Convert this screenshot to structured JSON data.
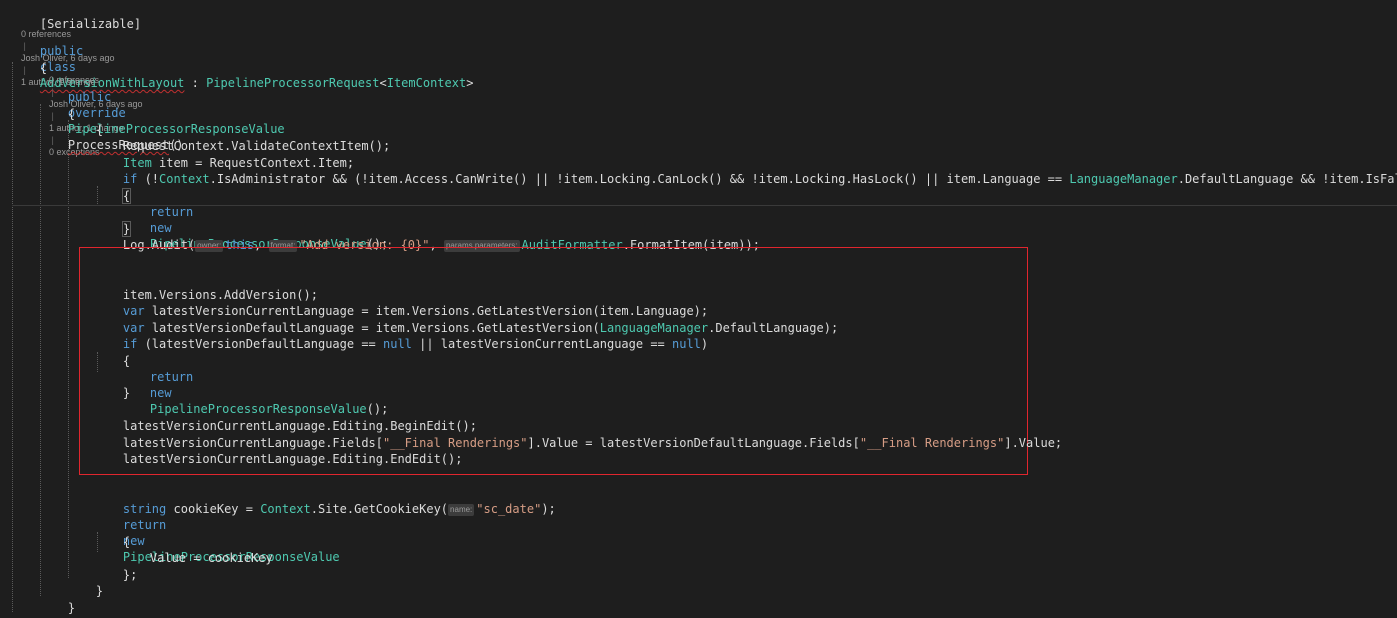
{
  "code": {
    "attribute_line": "[Serializable]",
    "class_lens": {
      "references": "0 references",
      "author": "Josh Oliver, 6 days ago",
      "changes": "1 author, 1 change"
    },
    "class_decl": {
      "kw1": "public",
      "kw2": "class",
      "name": "AddVersionWithLayout",
      "colon": " : ",
      "base": "PipelineProcessorRequest",
      "generic_open": "<",
      "generic_arg": "ItemContext",
      "generic_close": ">"
    },
    "method_lens": {
      "references": "0 references",
      "author": "Josh Oliver, 6 days ago",
      "changes": "1 author, 1 change",
      "exceptions": "0 exceptions"
    },
    "method_decl": {
      "kw1": "public",
      "kw2": "override",
      "return_type": "PipelineProcessorResponseValue",
      "name": "ProcessRequest",
      "parens": "()"
    },
    "open_brace": "{",
    "close_brace": "}",
    "l_validate": "RequestContext.ValidateContextItem();",
    "l_item_type": "Item",
    "l_item_rest": " item = RequestContext.Item;",
    "l_if_kw": "if",
    "l_if_a": " (!",
    "l_if_ctx": "Context",
    "l_if_b": ".IsAdministrator && (!item.Access.CanWrite() || !item.Locking.CanLock() && !item.Locking.HasLock() || item.Language == ",
    "l_if_lm": "LanguageManager",
    "l_if_c": ".DefaultLanguage && !item.IsFallback))",
    "return_kw": "return",
    "new_kw": "new",
    "response_type": "PipelineProcessorResponseValue",
    "call_end": "();",
    "log_a": "Log.Audit(",
    "hint_owner": "owner:",
    "this_kw": "this",
    "comma": ", ",
    "hint_format": "format:",
    "log_str": "\"Add version: {0}\"",
    "hint_params": "params parameters:",
    "log_formatter": "AuditFormatter",
    "log_end": ".FormatItem(item));",
    "l_addversion": "item.Versions.AddVersion();",
    "var_kw": "var",
    "l_var1_rest": " latestVersionCurrentLanguage = item.Versions.GetLatestVersion(item.Language);",
    "l_var2_a": " latestVersionDefaultLanguage = item.Versions.GetLatestVersion(",
    "l_var2_lm": "LanguageManager",
    "l_var2_b": ".DefaultLanguage);",
    "l_if2_a": " (latestVersionDefaultLanguage == ",
    "null_kw": "null",
    "l_if2_b": " || latestVersionCurrentLanguage == ",
    "l_if2_c": ")",
    "l_begin": "latestVersionCurrentLanguage.Editing.BeginEdit();",
    "l_fields_a": "latestVersionCurrentLanguage.Fields[",
    "l_fields_str": "\"__Final Renderings\"",
    "l_fields_b": "].Value = latestVersionDefaultLanguage.Fields[",
    "l_fields_c": "].Value;",
    "l_end": "latestVersionCurrentLanguage.Editing.EndEdit();",
    "string_kw": "string",
    "l_cookie_a": " cookieKey = ",
    "l_cookie_ctx": "Context",
    "l_cookie_b": ".Site.GetCookieKey(",
    "hint_name": "name:",
    "l_cookie_str": "\"sc_date\"",
    "l_cookie_end": ");",
    "l_value": "Value = cookieKey",
    "l_close_semi": "};"
  },
  "colors": {
    "background": "#1e1e1e",
    "keyword": "#569cd6",
    "type": "#4ec9b0",
    "string": "#d69d85",
    "highlight_box": "#e0262e"
  }
}
